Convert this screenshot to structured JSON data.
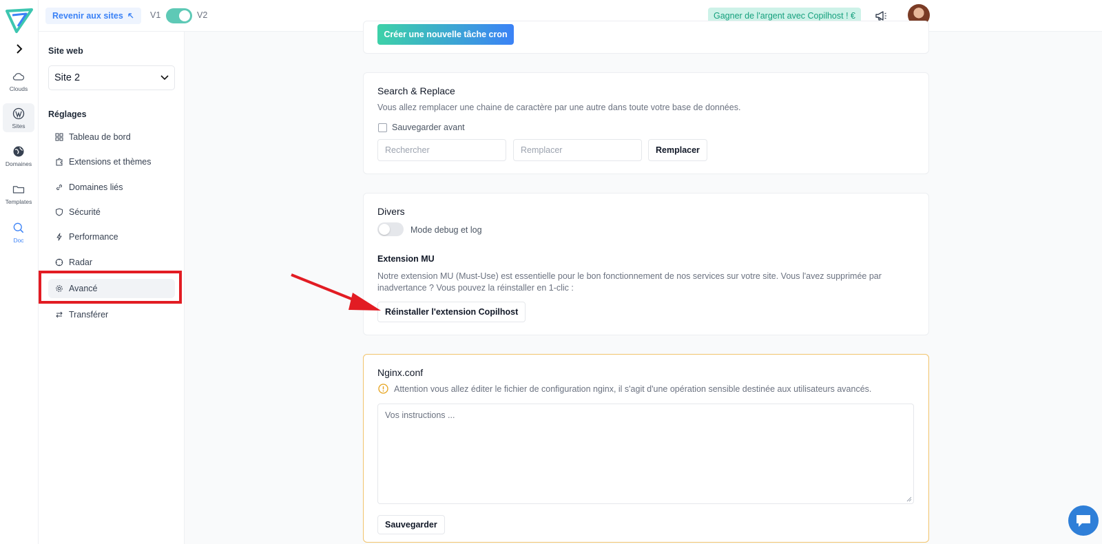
{
  "rail": {
    "items": [
      {
        "label": "Clouds",
        "icon": "cloud-icon"
      },
      {
        "label": "Sites",
        "icon": "wordpress-icon"
      },
      {
        "label": "Domaines",
        "icon": "globe-icon"
      },
      {
        "label": "Templates",
        "icon": "folder-icon"
      },
      {
        "label": "Doc",
        "icon": "search-icon"
      }
    ]
  },
  "topbar": {
    "back_label": "Revenir aux sites",
    "v1": "V1",
    "v2": "V2",
    "earn_label": "Gagner de l'argent avec Copilhost ! €"
  },
  "sidebar": {
    "site_heading": "Site web",
    "site_value": "Site 2",
    "settings_heading": "Réglages",
    "items": [
      {
        "label": "Tableau de bord",
        "icon": "dashboard-icon"
      },
      {
        "label": "Extensions et thèmes",
        "icon": "puzzle-icon"
      },
      {
        "label": "Domaines liés",
        "icon": "link-icon"
      },
      {
        "label": "Sécurité",
        "icon": "shield-icon"
      },
      {
        "label": "Performance",
        "icon": "bolt-icon"
      },
      {
        "label": "Radar",
        "icon": "radar-icon"
      },
      {
        "label": "Avancé",
        "icon": "gear-icon"
      },
      {
        "label": "Transférer",
        "icon": "transfer-icon"
      }
    ]
  },
  "cron": {
    "button_label": "Créer une nouvelle tâche cron"
  },
  "search_replace": {
    "title": "Search & Replace",
    "description": "Vous allez remplacer une chaine de caractère par une autre dans toute votre base de données.",
    "backup_label": "Sauvegarder avant",
    "search_placeholder": "Rechercher",
    "replace_placeholder": "Remplacer",
    "replace_button": "Remplacer"
  },
  "divers": {
    "title": "Divers",
    "debug_label": "Mode debug et log",
    "mu_title": "Extension MU",
    "mu_description_line1": "Notre extension MU (Must-Use) est essentielle pour le bon fonctionnement de nos services sur votre site. Vous l'avez supprimée par",
    "mu_description_line2": "inadvertance ? Vous pouvez la réinstaller en 1-clic :",
    "reinstall_button": "Réinstaller l'extension Copilhost"
  },
  "nginx": {
    "title": "Nginx.conf",
    "warning": "Attention vous allez éditer le fichier de configuration nginx, il s'agit d'une opération sensible destinée aux utilisateurs avancés.",
    "placeholder": "Vos instructions ...",
    "save_button": "Sauvegarder"
  },
  "colors": {
    "accent": "#3b82f6",
    "teal": "#5ec9b6",
    "highlight_red": "#e21c23",
    "warning": "#f1c36b"
  }
}
